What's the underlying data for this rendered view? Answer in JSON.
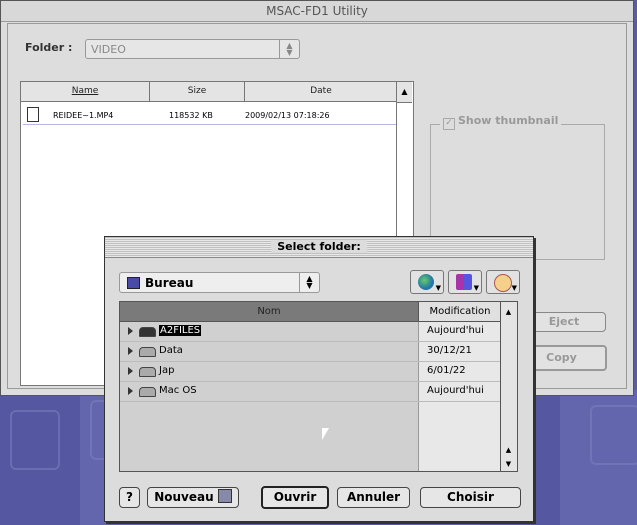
{
  "main_window": {
    "title": "MSAC-FD1 Utility",
    "folder_label": "Folder :",
    "folder_value": "VIDEO",
    "columns": [
      "Name",
      "Size",
      "Date"
    ],
    "file": {
      "name": "REIDEE~1.MP4",
      "size": "118532 KB",
      "date": "2009/02/13 07:18:26"
    },
    "show_thumbnail_label": "Show thumbnail",
    "eject_label": "Eject",
    "copy_label": "Copy"
  },
  "dialog": {
    "title": "Select folder:",
    "location": "Bureau",
    "col_name": "Nom",
    "col_modified": "Modification",
    "items": [
      {
        "name": "A2FILES",
        "modified": "Aujourd'hui"
      },
      {
        "name": "Data",
        "modified": "30/12/21"
      },
      {
        "name": "Jap",
        "modified": "6/01/22"
      },
      {
        "name": "Mac OS",
        "modified": "Aujourd'hui"
      }
    ],
    "help_label": "?",
    "new_label": "Nouveau",
    "open_label": "Ouvrir",
    "cancel_label": "Annuler",
    "choose_label": "Choisir"
  }
}
